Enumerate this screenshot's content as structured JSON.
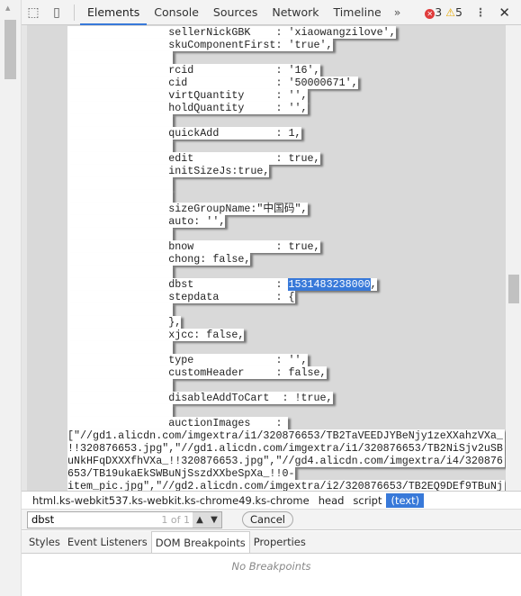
{
  "toolbar": {
    "tabs": [
      "Elements",
      "Console",
      "Sources",
      "Network",
      "Timeline"
    ],
    "active_tab": "Elements",
    "more": "»",
    "errors": "3",
    "warnings": "5"
  },
  "code": {
    "lines": [
      "                sellerNickGBK    : 'xiaowangzilove',",
      "                skuComponentFirst: 'true',",
      "",
      "                rcid             : '16',",
      "                cid              : '50000671',",
      "                virtQuantity     : '',",
      "                holdQuantity     : '',",
      "",
      "                quickAdd         : 1,",
      "",
      "                edit             : true,",
      "                initSizeJs:true,",
      "",
      "",
      "                sizeGroupName:\"中国码\",",
      "                auto: '',",
      "",
      "                bnow             : true,",
      "                chong: false,",
      "",
      "                dbst             : ",
      "                stepdata         : {",
      "",
      "                },",
      "                xjcc: false,",
      "",
      "                type             : '',",
      "                customHeader     : false,",
      "",
      "                disableAddToCart  : !true,",
      "",
      "                auctionImages    : "
    ],
    "match_value": "1531483238000",
    "match_suffix": ",",
    "wrapped": [
      "[\"//gd1.alicdn.com/imgextra/i1/320876653/TB2TaVEEDJYBeNjy1zeXXahzVXa_",
      "!!320876653.jpg\",\"//gd1.alicdn.com/imgextra/i1/320876653/TB2NiSjv2uSB",
      "uNkHFqDXXXfhVXa_!!320876653.jpg\",\"//gd4.alicdn.com/imgextra/i4/320876",
      "653/TB19ukaEkSWBuNjSszdXXbeSpXa_!!0-",
      "item_pic.jpg\",\"//gd2.alicdn.com/imgextra/i2/320876653/TB2EQ9DEf9TBuNj"
    ]
  },
  "breadcrumbs": [
    "html.ks-webkit537.ks-webkit.ks-chrome49.ks-chrome",
    "head",
    "script",
    "(text)"
  ],
  "search": {
    "value": "dbst",
    "count": "1 of 1",
    "cancel": "Cancel"
  },
  "panel_tabs": [
    "Styles",
    "Event Listeners",
    "DOM Breakpoints",
    "Properties"
  ],
  "active_panel_tab": "DOM Breakpoints",
  "pane": {
    "empty_text": "No Breakpoints"
  },
  "colors": {
    "accent": "#3879d9",
    "error": "#e03c3c",
    "warning": "#e6a800"
  }
}
